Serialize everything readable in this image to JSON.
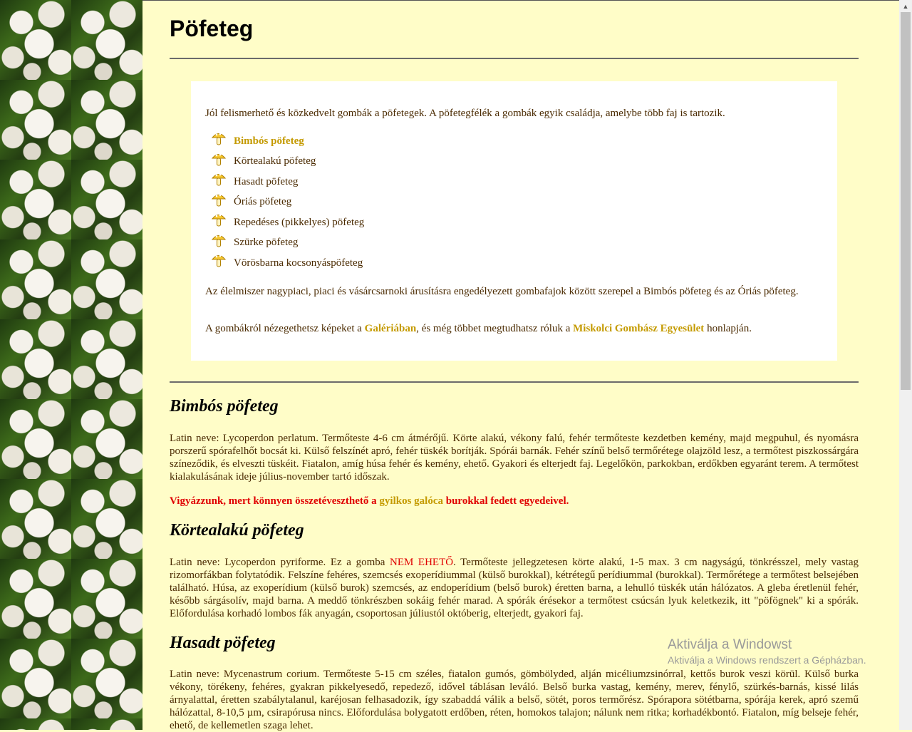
{
  "page": {
    "title": "Pöfeteg",
    "intro_text": "Jól felismerhető és közkedvelt gombák a pöfetegek. A pöfetegfélék a gombák egyik családja, amelybe több faj is tartozik.",
    "list": [
      {
        "label": "Bimbós pöfeteg",
        "link": true
      },
      {
        "label": "Körtealakú pöfeteg",
        "link": false
      },
      {
        "label": "Hasadt pöfeteg",
        "link": false
      },
      {
        "label": "Óriás pöfeteg",
        "link": false
      },
      {
        "label": "Repedéses (pikkelyes) pöfeteg",
        "link": false
      },
      {
        "label": "Szürke pöfeteg",
        "link": false
      },
      {
        "label": "Vörösbarna kocsonyáspöfeteg",
        "link": false
      }
    ],
    "market_text": "Az élelmiszer nagypiaci, piaci és vásárcsarnoki árusításra engedélyezett gombafajok között szerepel a Bimbós pöfeteg és az Óriás pöfeteg.",
    "gallery_pre": "A gombákról nézegethetsz képeket a ",
    "gallery_link": "Galériában",
    "gallery_mid": ", és még többet megtudhatsz róluk a ",
    "club_link": "Miskolci Gombász Egyesület",
    "gallery_post": " honlapján."
  },
  "sections": {
    "bimbos": {
      "title": "Bimbós pöfeteg",
      "text": "Latin neve: Lycoperdon perlatum. Termőteste 4-6 cm átmérőjű. Körte alakú, vékony falú, fehér termőteste kezdetben kemény, majd megpuhul, és nyomásra porszerű spórafelhőt bocsát ki. Külső felszínét apró, fehér tüskék borítják. Spórái barnák. Fehér színű belső termőrétege olajzöld lesz, a termőtest piszkossárgára színeződik, és elveszti tüskéit. Fiatalon, amíg húsa fehér és kemény, ehető. Gyakori és elterjedt faj. Legelőkön, parkokban, erdőkben egyaránt terem. A termőtest kialakulásának ideje július-november tartó időszak.",
      "warn_pre": "Vigyázzunk, mert könnyen összetéveszthető a ",
      "warn_link": "gyilkos galóca",
      "warn_post": " burokkal fedett egyedeivel."
    },
    "kortealaku": {
      "title": "Körtealakú pöfeteg",
      "text_pre": "Latin neve: Lycoperdon pyriforme. Ez a gomba ",
      "not_edible": "NEM EHETŐ",
      "text_post": ". Termőteste jellegzetesen körte alakú, 1-5 max. 3 cm nagyságú, tönkrésszel, mely vastag rizomorfákban folytatódik. Felszíne fehéres, szemcsés exoperídiummal (külső burokkal), kétrétegű perídiummal (burokkal). Termőrétege a termőtest belsejében található. Húsa, az exoperídium (külső burok) szemcsés, az endoperídium (belső burok) éretten barna, a lehulló tüskék után hálózatos. A gleba éretlenül fehér, később sárgásolív, majd barna. A meddő tönkrészben sokáig fehér marad. A spórák érésekor a termőtest csúcsán lyuk keletkezik, itt \"pöfögnek\" ki a spórák. Előfordulása korhadó lombos fák anyagán, csoportosan júliustól októberig, elterjedt, gyakori faj."
    },
    "hasadt": {
      "title": "Hasadt pöfeteg",
      "text": "Latin neve: Mycenastrum corium. Termőteste 5-15 cm széles, fiatalon gumós, gömbölyded, alján micéliumzsinórral, kettős burok veszi körül. Külső burka vékony, törékeny, fehéres, gyakran pikkelyesedő, repedező, idővel táblásan leváló. Belső burka vastag, kemény, merev, fénylő, szürkés-barnás, kissé lilás árnyalattal, éretten szabálytalanul, karéjosan felhasadozik, így szabaddá válik a belső, sötét, poros termőrész. Spórapora sötétbarna, spórája kerek, apró szemű hálózattal, 8-10,5 µm, csirapórusa nincs. Előfordulása bolygatott erdőben, réten, homokos talajon; nálunk nem ritka; korhadékbontó. Fiatalon, míg belseje fehér, ehető, de kellemetlen szaga lehet."
    }
  },
  "watermark": {
    "title": "Aktiválja a Windowst",
    "subtitle": "Aktiválja a Windows rendszert a Gépházban."
  },
  "colors": {
    "page_bg": "#fffdc8",
    "text": "#4a2a00",
    "link": "#c49a00",
    "warning": "#e00000"
  }
}
